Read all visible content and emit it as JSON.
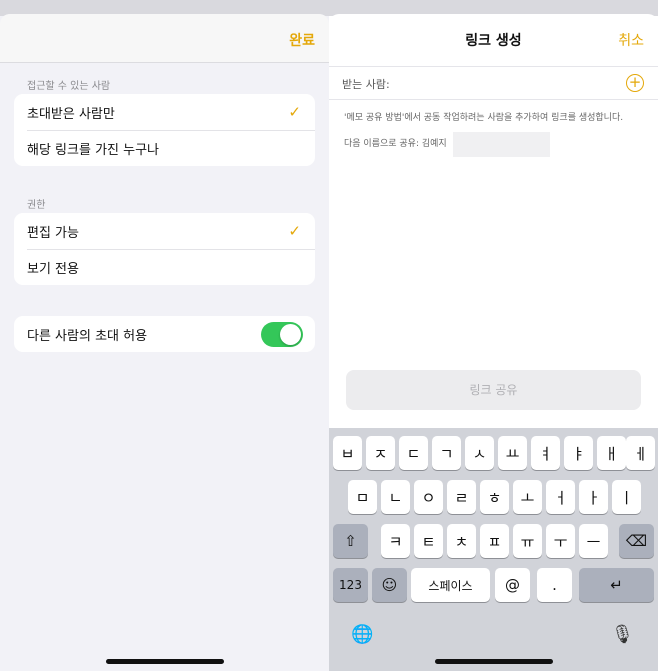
{
  "left_panel": {
    "done_label": "완료",
    "access_section_label": "접근할 수 있는 사람",
    "access_options": [
      "초대받은 사람만",
      "해당 링크를 가진 누구나"
    ],
    "permission_section_label": "권한",
    "permission_options": [
      "편집 가능",
      "보기 전용"
    ],
    "allow_invite_label": "다른 사람의 초대 허용",
    "allow_invite_enabled": true,
    "checkmark_glyph": "✓"
  },
  "right_panel": {
    "title": "링크 생성",
    "cancel_label": "취소",
    "recipients_label": "받는 사람:",
    "info_text": "'메모 공유 방법'에서 공동 작업하려는 사람을 추가하여 링크를 생성합니다.",
    "share_as_label": "다음 이름으로 공유: 김예지",
    "share_link_button": "링크 공유"
  },
  "keyboard": {
    "row1": [
      "ㅂ",
      "ㅈ",
      "ㄷ",
      "ㄱ",
      "ㅅ",
      "ㅛ",
      "ㅕ",
      "ㅑ",
      "ㅐ",
      "ㅔ"
    ],
    "row2": [
      "ㅁ",
      "ㄴ",
      "ㅇ",
      "ㄹ",
      "ㅎ",
      "ㅗ",
      "ㅓ",
      "ㅏ",
      "ㅣ"
    ],
    "row3": [
      "ㅋ",
      "ㅌ",
      "ㅊ",
      "ㅍ",
      "ㅠ",
      "ㅜ",
      "ㅡ"
    ],
    "numbers_key": "123",
    "space_key": "스페이스",
    "at_key": "@",
    "period_key": ".",
    "shift_glyph": "⇧",
    "delete_glyph": "⌫",
    "emoji_glyph": "☺",
    "return_glyph": "↵",
    "globe_glyph": "🌐",
    "mic_glyph": "🎙"
  },
  "colors": {
    "accent": "#e4a80a",
    "toggle_on": "#34c759",
    "grouped_background": "#f2f2f7",
    "keyboard_background": "#d1d3d9"
  }
}
